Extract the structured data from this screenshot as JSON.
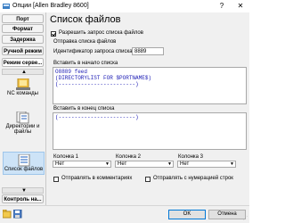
{
  "window": {
    "title": "Опции [Allen Bradley 8600]",
    "help_glyph": "?",
    "close_glyph": "✕"
  },
  "nav": {
    "tabs": [
      "Порт",
      "Формат",
      "Задержка",
      "Ручной режим",
      "Режим серве..."
    ],
    "items": [
      {
        "label": "NC команды",
        "icon": "nc-commands-icon"
      },
      {
        "label": "Директории и файлы",
        "icon": "folders-icon"
      },
      {
        "label": "Список файлов",
        "icon": "file-list-icon",
        "selected": true
      }
    ],
    "bottom_tab": "Контроль на...",
    "scroll_up": "▲",
    "scroll_down": "▼"
  },
  "page": {
    "title": "Список файлов",
    "enable_label": "Разрешить запрос списка файлов",
    "enable_checked": true,
    "send_section": "Отправка списка файлов",
    "request_id_label": "Идентификатор запроса списка",
    "request_id_value": "8889",
    "insert_start_label": "Вставить в начало списка",
    "insert_start_lines": [
      {
        "text": "O8889 feed",
        "color": "blue"
      },
      {
        "text": "(DIRECTORYLIST FOR $PORTNAME$)",
        "color": "blue"
      },
      {
        "text": "(------------------------)",
        "color": "blue"
      }
    ],
    "insert_end_label": "Вставить в конец списка",
    "insert_end_lines": [
      {
        "text": "(------------------------)",
        "color": "blue"
      }
    ],
    "columns": [
      {
        "label": "Колонка 1",
        "value": "Нет"
      },
      {
        "label": "Колонка 2",
        "value": "Нет"
      },
      {
        "label": "Колонка 3",
        "value": "Нет"
      }
    ],
    "send_comments_label": "Отправлять в комментариях",
    "send_comments_checked": false,
    "send_numbered_label": "Отправлять с нумерацией строк",
    "send_numbered_checked": false
  },
  "footer": {
    "ok": "OK",
    "cancel": "Отмена"
  }
}
